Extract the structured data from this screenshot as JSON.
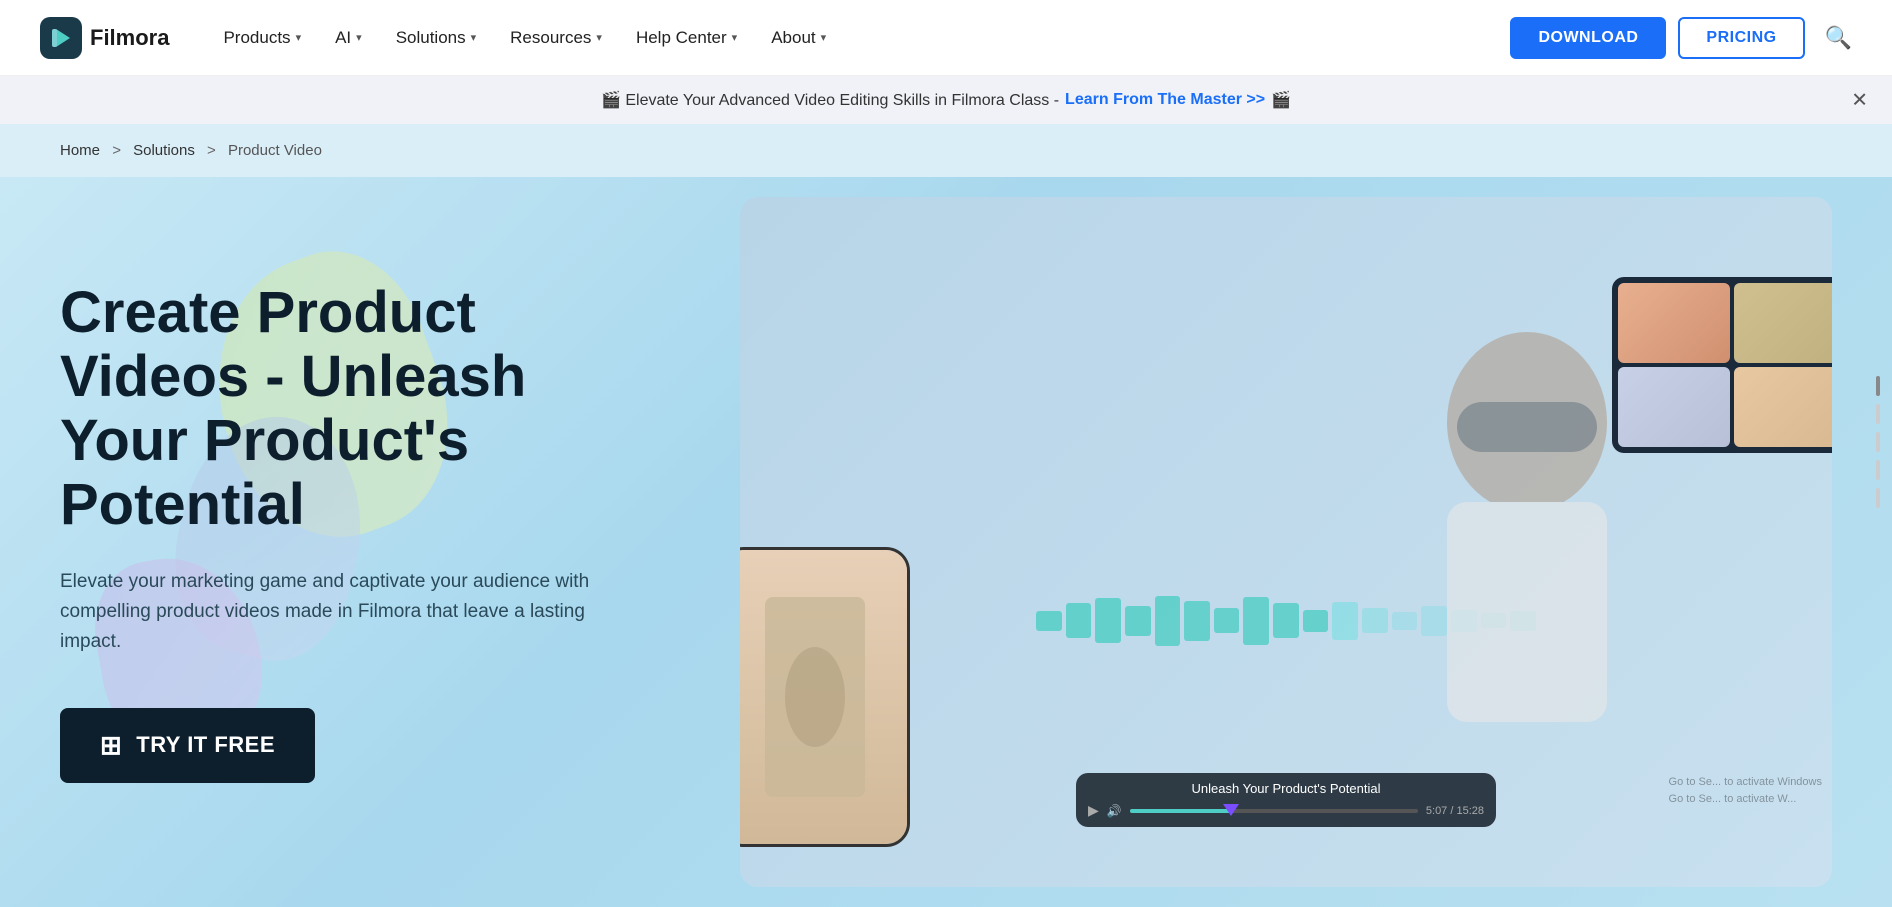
{
  "navbar": {
    "logo_icon": "🎬",
    "logo_text": "Filmora",
    "items": [
      {
        "label": "Products",
        "has_chevron": true
      },
      {
        "label": "AI",
        "has_chevron": true
      },
      {
        "label": "Solutions",
        "has_chevron": true
      },
      {
        "label": "Resources",
        "has_chevron": true
      },
      {
        "label": "Help Center",
        "has_chevron": true
      },
      {
        "label": "About",
        "has_chevron": true
      }
    ],
    "btn_download": "DOWNLOAD",
    "btn_pricing": "PRICING"
  },
  "banner": {
    "prefix": "🎬 Elevate Your Advanced Video Editing Skills in Filmora Class -",
    "link_text": "Learn From The Master >>",
    "suffix": "🎬"
  },
  "breadcrumb": {
    "home": "Home",
    "solutions": "Solutions",
    "current": "Product Video"
  },
  "hero": {
    "title": "Create Product Videos - Unleash Your Product's Potential",
    "subtitle": "Elevate your marketing game and captivate your audience with compelling product videos made in Filmora that leave a lasting impact.",
    "cta_label": "TRY IT FREE",
    "video_title": "Unleash Your Product's Potential",
    "video_time": "5:07 / 15:28"
  },
  "activate_windows": {
    "line1": "Go to Se... to activate Windows",
    "line2": "Go to Se... to activate W..."
  }
}
